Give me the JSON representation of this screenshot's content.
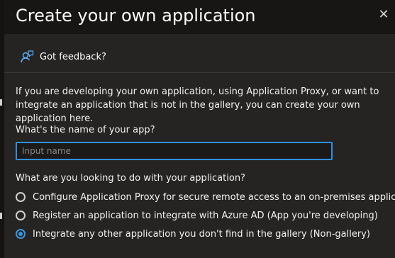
{
  "dialog": {
    "title": "Create your own application"
  },
  "toolbar": {
    "feedback_label": "Got feedback?",
    "feedback_icon": "feedback-person-icon",
    "close_icon": "close-icon"
  },
  "content": {
    "intro": "If you are developing your own application, using Application Proxy, or want to integrate an application that is not in the gallery, you can create your own application here.",
    "name_question": "What's the name of your app?",
    "name_input": {
      "value": "",
      "placeholder": "Input name"
    },
    "purpose_question": "What are you looking to do with your application?",
    "options": [
      {
        "label": "Configure Application Proxy for secure remote access to an on-premises application",
        "selected": false
      },
      {
        "label": "Register an application to integrate with Azure AD (App you're developing)",
        "selected": false
      },
      {
        "label": "Integrate any other application you don't find in the gallery (Non-gallery)",
        "selected": true
      }
    ]
  },
  "colors": {
    "accent": "#3a96dd",
    "input_focus_border": "#2f8fe0",
    "panel_background": "#252423",
    "header_background": "#171615"
  }
}
